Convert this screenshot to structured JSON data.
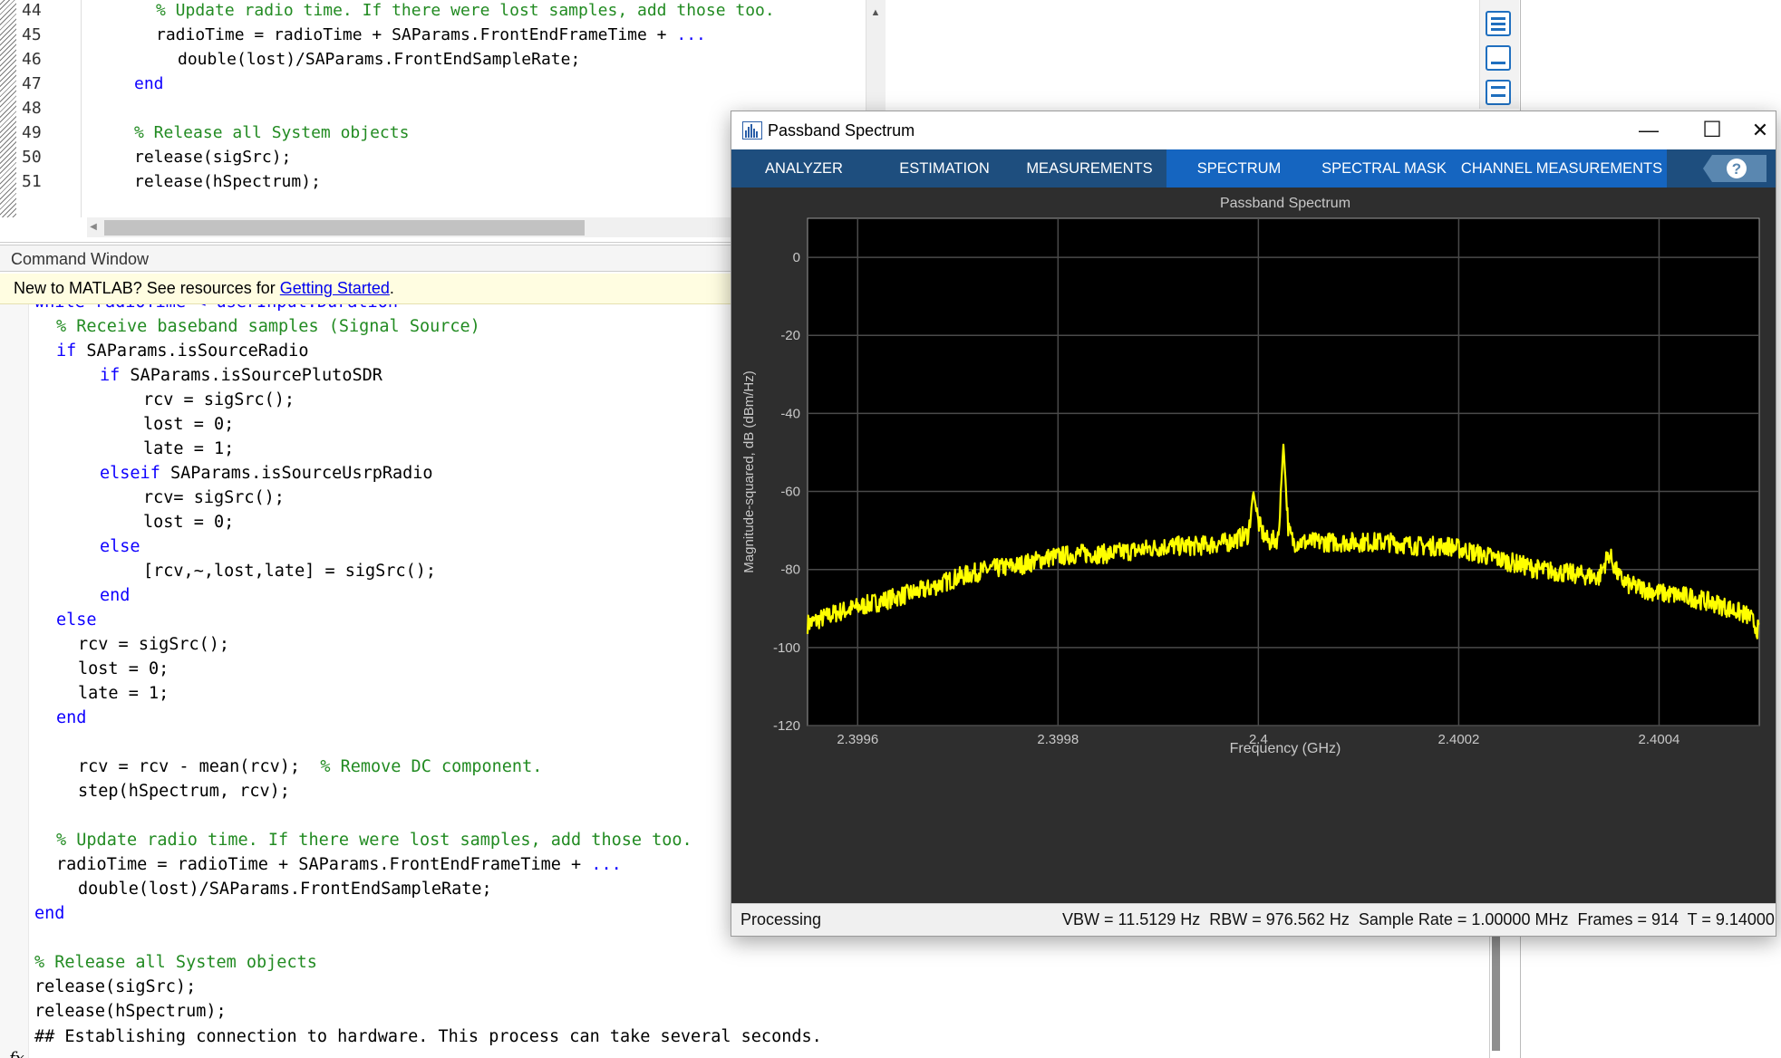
{
  "editor": {
    "lines": [
      {
        "num": "44",
        "indent": 3,
        "parts": [
          {
            "t": "% Update radio time. If there were lost samples, add those too.",
            "c": "cm"
          }
        ]
      },
      {
        "num": "45",
        "indent": 3,
        "parts": [
          {
            "t": "radioTime = radioTime + SAParams.FrontEndFrameTime + ",
            "c": ""
          },
          {
            "t": "...",
            "c": "kw"
          }
        ]
      },
      {
        "num": "46",
        "indent": 4,
        "parts": [
          {
            "t": "double(lost)/SAParams.FrontEndSampleRate;",
            "c": ""
          }
        ]
      },
      {
        "num": "47",
        "indent": 2,
        "parts": [
          {
            "t": "end",
            "c": "kw"
          }
        ]
      },
      {
        "num": "48",
        "indent": 0,
        "parts": []
      },
      {
        "num": "49",
        "indent": 2,
        "parts": [
          {
            "t": "% Release all System objects",
            "c": "cm"
          }
        ]
      },
      {
        "num": "50",
        "indent": 2,
        "parts": [
          {
            "t": "release(sigSrc);",
            "c": ""
          }
        ]
      },
      {
        "num": "51",
        "indent": 2,
        "parts": [
          {
            "t": "release(hSpectrum);",
            "c": ""
          }
        ]
      }
    ]
  },
  "command_window": {
    "title": "Command Window",
    "banner_prefix": "New to MATLAB? See resources for ",
    "banner_link": "Getting Started",
    "banner_suffix": ".",
    "lines": [
      {
        "x": 38,
        "parts": [
          {
            "t": "while radioTime < userInput.Duration",
            "c": "kw"
          }
        ]
      },
      {
        "x": 62,
        "parts": [
          {
            "t": "% Receive baseband samples (Signal Source)",
            "c": "cm"
          }
        ]
      },
      {
        "x": 62,
        "parts": [
          {
            "t": "if",
            "c": "kw"
          },
          {
            "t": " SAParams.isSourceRadio",
            "c": ""
          }
        ]
      },
      {
        "x": 110,
        "parts": [
          {
            "t": "if",
            "c": "kw"
          },
          {
            "t": " SAParams.isSourcePlutoSDR",
            "c": ""
          }
        ]
      },
      {
        "x": 158,
        "parts": [
          {
            "t": "rcv = sigSrc();",
            "c": ""
          }
        ]
      },
      {
        "x": 158,
        "parts": [
          {
            "t": "lost = 0;",
            "c": ""
          }
        ]
      },
      {
        "x": 158,
        "parts": [
          {
            "t": "late = 1;",
            "c": ""
          }
        ]
      },
      {
        "x": 110,
        "parts": [
          {
            "t": "elseif",
            "c": "kw"
          },
          {
            "t": " SAParams.isSourceUsrpRadio",
            "c": ""
          }
        ]
      },
      {
        "x": 158,
        "parts": [
          {
            "t": "rcv= sigSrc();",
            "c": ""
          }
        ]
      },
      {
        "x": 158,
        "parts": [
          {
            "t": "lost = 0;",
            "c": ""
          }
        ]
      },
      {
        "x": 110,
        "parts": [
          {
            "t": "else",
            "c": "kw"
          }
        ]
      },
      {
        "x": 158,
        "parts": [
          {
            "t": "[rcv,~,lost,late] = sigSrc();",
            "c": ""
          }
        ]
      },
      {
        "x": 110,
        "parts": [
          {
            "t": "end",
            "c": "kw"
          }
        ]
      },
      {
        "x": 62,
        "parts": [
          {
            "t": "else",
            "c": "kw"
          }
        ]
      },
      {
        "x": 86,
        "parts": [
          {
            "t": "rcv = sigSrc();",
            "c": ""
          }
        ]
      },
      {
        "x": 86,
        "parts": [
          {
            "t": "lost = 0;",
            "c": ""
          }
        ]
      },
      {
        "x": 86,
        "parts": [
          {
            "t": "late = 1;",
            "c": ""
          }
        ]
      },
      {
        "x": 62,
        "parts": [
          {
            "t": "end",
            "c": "kw"
          }
        ]
      },
      {
        "x": 62,
        "parts": []
      },
      {
        "x": 86,
        "parts": [
          {
            "t": "rcv = rcv - mean(rcv);  ",
            "c": ""
          },
          {
            "t": "% Remove DC component.",
            "c": "cm"
          }
        ]
      },
      {
        "x": 86,
        "parts": [
          {
            "t": "step(hSpectrum, rcv);",
            "c": ""
          }
        ]
      },
      {
        "x": 62,
        "parts": []
      },
      {
        "x": 62,
        "parts": [
          {
            "t": "% Update radio time. If there were lost samples, add those too.",
            "c": "cm"
          }
        ]
      },
      {
        "x": 62,
        "parts": [
          {
            "t": "radioTime = radioTime + SAParams.FrontEndFrameTime + ",
            "c": ""
          },
          {
            "t": "...",
            "c": "kw"
          }
        ]
      },
      {
        "x": 86,
        "parts": [
          {
            "t": "double(lost)/SAParams.FrontEndSampleRate;",
            "c": ""
          }
        ]
      },
      {
        "x": 38,
        "parts": [
          {
            "t": "end",
            "c": "kw"
          }
        ]
      },
      {
        "x": 38,
        "parts": []
      },
      {
        "x": 38,
        "parts": [
          {
            "t": "% Release all System objects",
            "c": "cm"
          }
        ]
      },
      {
        "x": 38,
        "parts": [
          {
            "t": "release(sigSrc);",
            "c": ""
          }
        ]
      },
      {
        "x": 38,
        "parts": [
          {
            "t": "release(hSpectrum);",
            "c": ""
          }
        ]
      }
    ],
    "output": "## Establishing connection to hardware. This process can take several seconds.",
    "prompt_symbol": "fx"
  },
  "spectrum_window": {
    "title": "Passband Spectrum",
    "minimize": "—",
    "maximize": "☐",
    "close": "✕",
    "tabs": [
      "ANALYZER",
      "ESTIMATION",
      "MEASUREMENTS",
      "SPECTRUM",
      "SPECTRAL MASK",
      "CHANNEL MEASUREMENTS"
    ],
    "help": "?",
    "status_left": "Processing",
    "status_right": "VBW = 11.5129 Hz  RBW = 976.562 Hz  Sample Rate = 1.00000 MHz  Frames = 914  T = 9.14000"
  },
  "colors": {
    "trace": "#ffff00",
    "plot_bg": "#000000",
    "figure_bg": "#2e2e2e",
    "ribbon": "#1e4e7e",
    "ribbon_active": "#1565c0",
    "keyword": "#0e00ff",
    "comment": "#228b22"
  },
  "chart_data": {
    "type": "line",
    "title": "Passband Spectrum",
    "xlabel": "Frequency (GHz)",
    "ylabel": "Magnitude-squared, dB (dBm/Hz)",
    "xlim": [
      2.39955,
      2.4005
    ],
    "ylim": [
      -120,
      10
    ],
    "xticks": [
      2.3996,
      2.3998,
      2.4,
      2.4002,
      2.4004
    ],
    "xtick_labels": [
      "2.3996",
      "2.3998",
      "2.4",
      "2.4002",
      "2.4004"
    ],
    "yticks": [
      0,
      -20,
      -40,
      -60,
      -80,
      -100,
      -120
    ],
    "ytick_labels": [
      "0",
      "-20",
      "-40",
      "-60",
      "-80",
      "-100",
      "-120"
    ],
    "grid": true,
    "series": [
      {
        "color": "#ffff00",
        "x": [
          2.39955,
          2.39958,
          2.39961,
          2.39964,
          2.39967,
          2.3997,
          2.39973,
          2.39976,
          2.39979,
          2.39982,
          2.39985,
          2.39988,
          2.39991,
          2.39994,
          2.39997,
          2.39999,
          2.399995,
          2.4,
          2.400005,
          2.40001,
          2.40002,
          2.400025,
          2.40003,
          2.400035,
          2.40004,
          2.40007,
          2.4001,
          2.40013,
          2.40016,
          2.40019,
          2.40022,
          2.40025,
          2.40028,
          2.40031,
          2.40034,
          2.40035,
          2.40036,
          2.40037,
          2.4004,
          2.40043,
          2.40046,
          2.40049,
          2.4005
        ],
        "y": [
          -94,
          -91,
          -89,
          -87,
          -85,
          -82,
          -80,
          -79,
          -77,
          -76,
          -76,
          -75,
          -74,
          -74,
          -73,
          -71,
          -60,
          -68,
          -71,
          -73,
          -72,
          -48,
          -70,
          -73,
          -73,
          -73,
          -73,
          -73,
          -74,
          -74,
          -76,
          -78,
          -80,
          -81,
          -82,
          -76,
          -82,
          -84,
          -86,
          -87,
          -89,
          -92,
          -96
        ]
      }
    ]
  }
}
